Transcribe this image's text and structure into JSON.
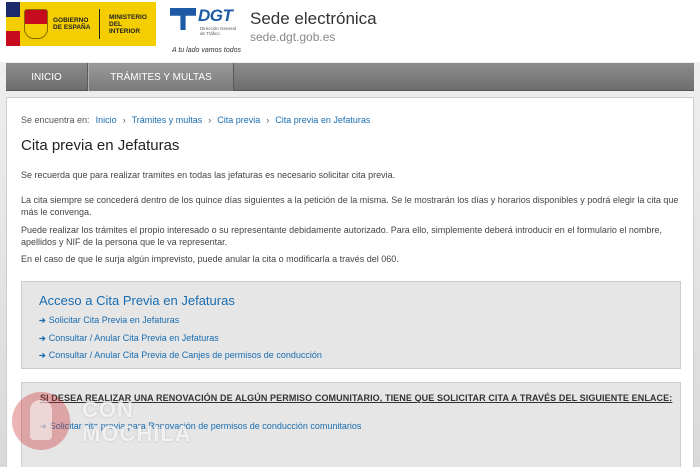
{
  "header": {
    "gov_logo_text_1": "GOBIERNO DE ESPAÑA",
    "gov_logo_text_2": "MINISTERIO DEL INTERIOR",
    "dgt_logo": "DGT",
    "dgt_sub": "Dirección General de Tráfico",
    "tagline": "A tu lado vamos todos",
    "site_title": "Sede electrónica",
    "site_url": "sede.dgt.gob.es"
  },
  "nav": {
    "inicio": "INICIO",
    "tramites": "TRÁMITES Y MULTAS"
  },
  "breadcrumb": {
    "label": "Se encuentra en:",
    "items": [
      "Inicio",
      "Trámites y multas",
      "Cita previa",
      "Cita previa en Jefaturas"
    ]
  },
  "page": {
    "title": "Cita previa en Jefaturas",
    "paragraphs": [
      "Se recuerda que para realizar tramites en todas las jefaturas es necesario solicitar cita previa.",
      "La cita siempre se concederá dentro de los quince días siguientes a la petición de la misma. Se le mostrarán los días y horarios disponibles y podrá elegir la cita que más le convenga.",
      "Puede realizar los trámites el propio interesado o su representante debidamente autorizado. Para ello, simplemente deberá introducir en el formulario el nombre, apellidos y NIF de la persona que le va representar.",
      "En el caso de que le surja algún imprevisto, puede anular la cita o modificarla a través del 060."
    ]
  },
  "access": {
    "title": "Acceso a Cita Previa en Jefaturas",
    "links": [
      "Solicitar Cita Previa en Jefaturas",
      "Consultar / Anular Cita Previa en Jefaturas",
      "Consultar / Anular Cita Previa de Canjes de permisos de conducción"
    ]
  },
  "notice": {
    "title": "SI DESEA REALIZAR UNA RENOVACIÓN DE ALGÚN PERMISO COMUNITARIO, TIENE QUE SOLICITAR CITA A TRAVÉS DEL SIGUIENTE ENLACE:",
    "link": "Solicitar cita previa para Renovación de permisos de conducción comunitarios"
  },
  "watermark": {
    "line1": "CON",
    "line2": "MOCHILA"
  },
  "colors": {
    "link": "#1a6db0",
    "nav": "#7a7a7a"
  }
}
